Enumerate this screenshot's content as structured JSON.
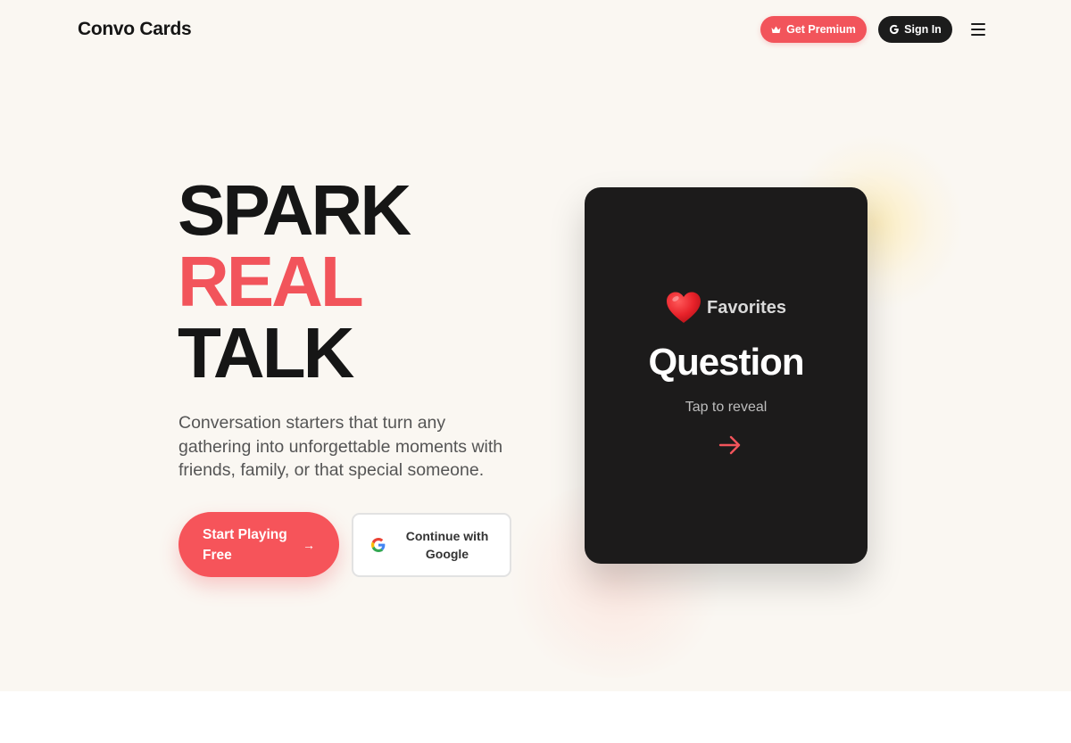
{
  "header": {
    "logo": "Convo Cards",
    "premium_label": "Get Premium",
    "signin_label": "Sign In",
    "icons": {
      "premium": "crown-icon",
      "signin": "google-g-icon",
      "menu": "hamburger-menu-icon"
    }
  },
  "hero": {
    "headline": [
      "SPARK",
      "REAL",
      "TALK"
    ],
    "description": "Conversation starters that turn any gathering into unforgettable moments with friends, family, or that special someone.",
    "start_button": "Start Playing Free",
    "google_button": "Continue with Google"
  },
  "card": {
    "category": "Favorites",
    "category_icon": "heart-icon",
    "title": "Question",
    "hint": "Tap to reveal",
    "arrow_icon": "arrow-right-icon"
  },
  "colors": {
    "accent": "#f2545b",
    "dark": "#1c1c1c",
    "background": "#faf7f2"
  }
}
